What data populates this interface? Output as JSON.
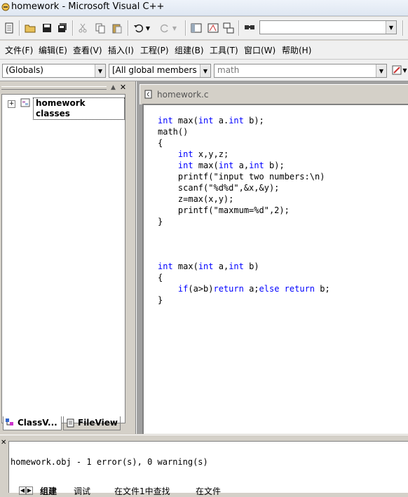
{
  "window": {
    "title": "homework - Microsoft Visual C++"
  },
  "toolbar": {
    "find_value": "",
    "icons": [
      "new-text-file-icon",
      "open-icon",
      "save-icon",
      "save-all-icon",
      "cut-icon",
      "copy-icon",
      "paste-icon",
      "undo-icon",
      "redo-icon",
      "workspace-icon",
      "output-icon",
      "window-list-icon",
      "find-in-files-icon"
    ]
  },
  "menubar": {
    "items": [
      "文件(F)",
      "编辑(E)",
      "查看(V)",
      "插入(I)",
      "工程(P)",
      "组建(B)",
      "工具(T)",
      "窗口(W)",
      "帮助(H)"
    ]
  },
  "wizardbar": {
    "class_combo": "(Globals)",
    "filter_combo": "[All global members",
    "members_combo": "math"
  },
  "workspace": {
    "tree_root": "homework classes",
    "tabs": [
      "ClassV...",
      "FileView"
    ]
  },
  "editor": {
    "tab_title": "homework.c",
    "code_lines": [
      [
        {
          "t": "int",
          "k": 1
        },
        {
          "t": " max("
        },
        {
          "t": "int",
          "k": 1
        },
        {
          "t": " a."
        },
        {
          "t": "int",
          "k": 1
        },
        {
          "t": " b);"
        }
      ],
      [
        {
          "t": "math()"
        }
      ],
      [
        {
          "t": "{"
        }
      ],
      [
        {
          "t": "    "
        },
        {
          "t": "int",
          "k": 1
        },
        {
          "t": " x,y,z;"
        }
      ],
      [
        {
          "t": "    "
        },
        {
          "t": "int",
          "k": 1
        },
        {
          "t": " max("
        },
        {
          "t": "int",
          "k": 1
        },
        {
          "t": " a,"
        },
        {
          "t": "int",
          "k": 1
        },
        {
          "t": " b);"
        }
      ],
      [
        {
          "t": "    printf(\"input two numbers:\\n)"
        }
      ],
      [
        {
          "t": "    scanf(\"%d%d\",&x,&y);"
        }
      ],
      [
        {
          "t": "    z=max(x,y);"
        }
      ],
      [
        {
          "t": "    printf(\"maxmum=%d\",2);"
        }
      ],
      [
        {
          "t": "}"
        }
      ],
      [
        {
          "t": ""
        }
      ],
      [
        {
          "t": ""
        }
      ],
      [
        {
          "t": ""
        }
      ],
      [
        {
          "t": "int",
          "k": 1
        },
        {
          "t": " max("
        },
        {
          "t": "int",
          "k": 1
        },
        {
          "t": " a,"
        },
        {
          "t": "int",
          "k": 1
        },
        {
          "t": " b)"
        }
      ],
      [
        {
          "t": "{"
        }
      ],
      [
        {
          "t": "    "
        },
        {
          "t": "if",
          "k": 1
        },
        {
          "t": "(a>b)"
        },
        {
          "t": "return",
          "k": 1
        },
        {
          "t": " a;"
        },
        {
          "t": "else",
          "k": 1
        },
        {
          "t": " "
        },
        {
          "t": "return",
          "k": 1
        },
        {
          "t": " b;"
        }
      ],
      [
        {
          "t": "}"
        }
      ]
    ]
  },
  "output": {
    "message": "homework.obj - 1 error(s), 0 warning(s)",
    "tabs": [
      "组建",
      "调试",
      "在文件1中查找",
      "在文件"
    ]
  }
}
